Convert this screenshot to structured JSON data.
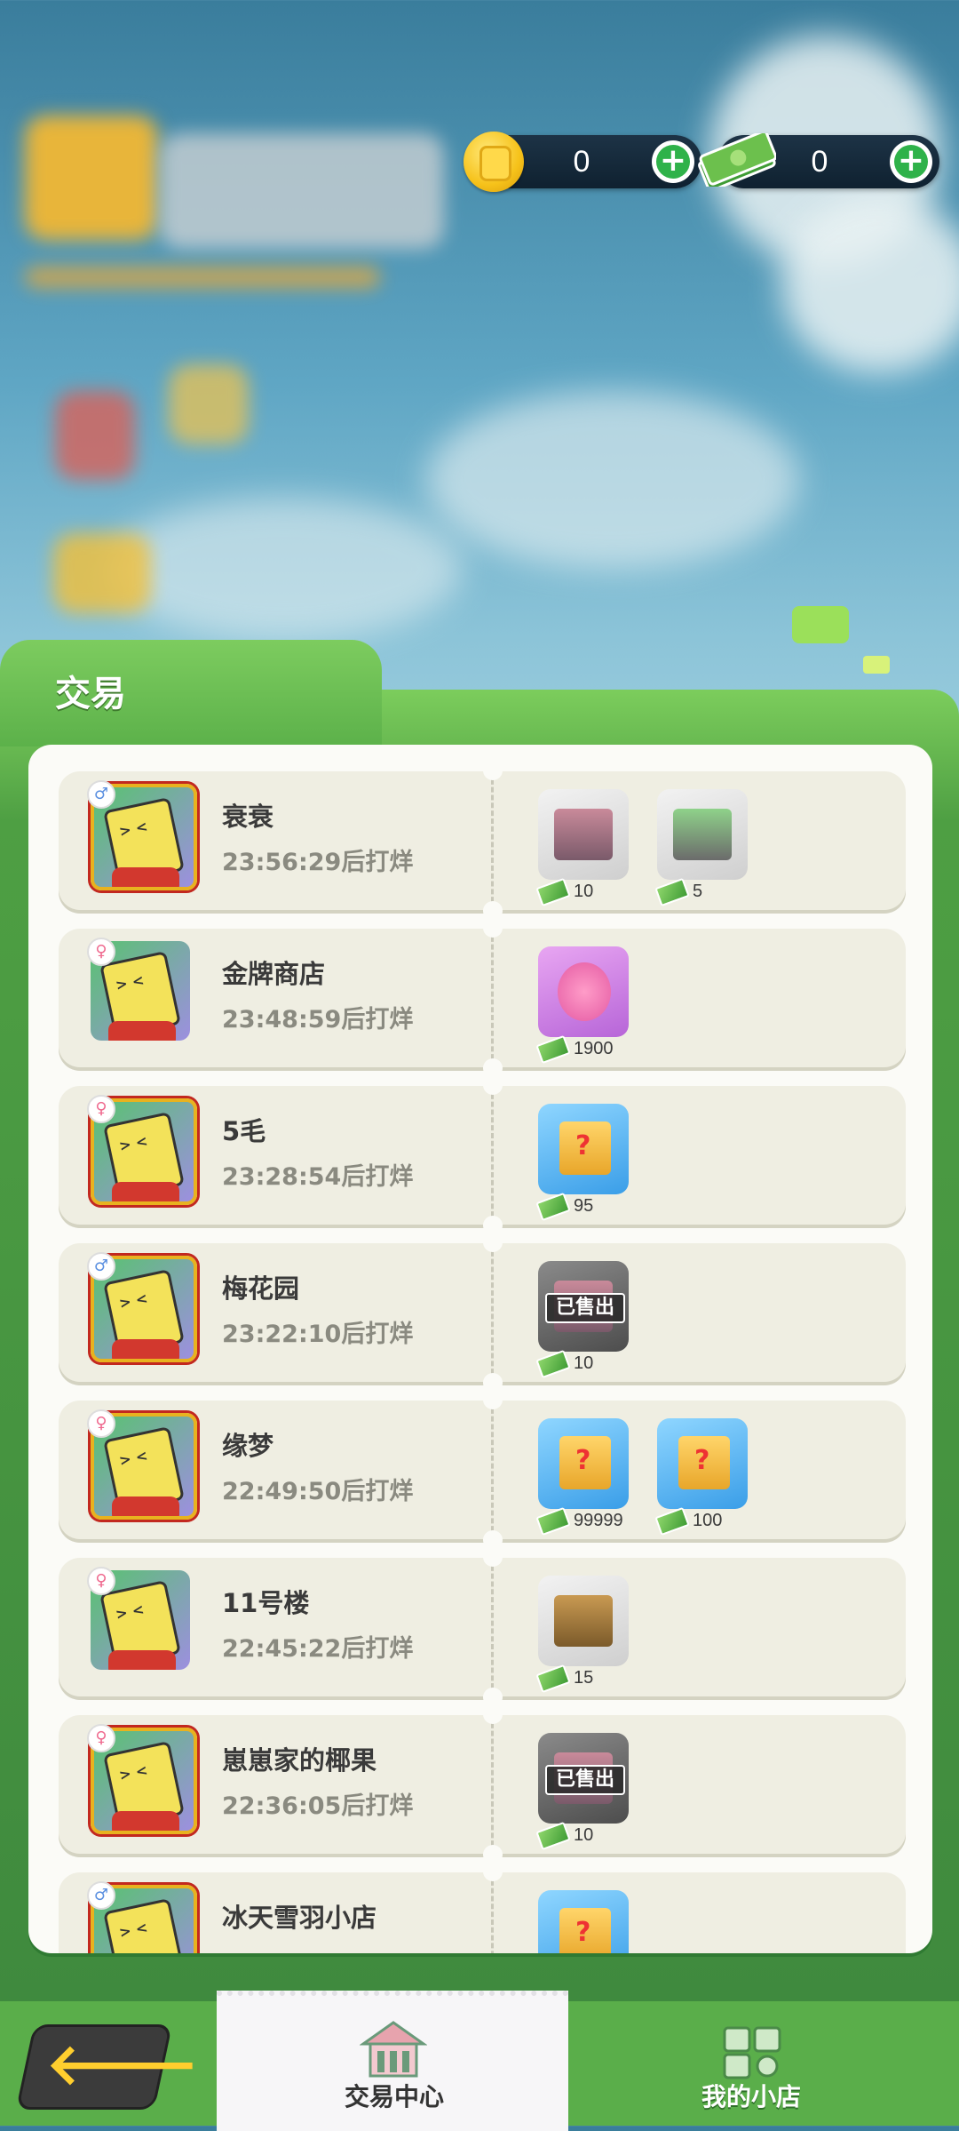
{
  "currency": {
    "coins": "0",
    "cash": "0",
    "coin_icon": "gold-coin-icon",
    "cash_icon": "cash-stack-icon",
    "add_icon": "plus-icon"
  },
  "panel": {
    "title": "交易"
  },
  "listings": [
    {
      "name": "衰衰",
      "timer": "23:56:29后打烊",
      "gender": "male",
      "framed": true,
      "items": [
        {
          "kind": "building",
          "price": "10",
          "sold": false
        },
        {
          "kind": "store",
          "price": "5",
          "sold": false
        }
      ]
    },
    {
      "name": "金牌商店",
      "timer": "23:48:59后打烊",
      "gender": "female",
      "framed": false,
      "items": [
        {
          "kind": "flower-gift",
          "price": "1900",
          "sold": false
        }
      ]
    },
    {
      "name": "5毛",
      "timer": "23:28:54后打烊",
      "gender": "female",
      "framed": true,
      "items": [
        {
          "kind": "mystery-box",
          "price": "95",
          "sold": false
        }
      ]
    },
    {
      "name": "梅花园",
      "timer": "23:22:10后打烊",
      "gender": "male",
      "framed": true,
      "items": [
        {
          "kind": "building",
          "price": "10",
          "sold": true
        }
      ]
    },
    {
      "name": "缘梦",
      "timer": "22:49:50后打烊",
      "gender": "female",
      "framed": true,
      "items": [
        {
          "kind": "mystery-box",
          "price": "99999",
          "sold": false
        },
        {
          "kind": "mystery-box",
          "price": "100",
          "sold": false
        }
      ]
    },
    {
      "name": "11号楼",
      "timer": "22:45:22后打烊",
      "gender": "female",
      "framed": false,
      "items": [
        {
          "kind": "farm",
          "price": "15",
          "sold": false
        }
      ]
    },
    {
      "name": "崽崽家的椰果",
      "timer": "22:36:05后打烊",
      "gender": "female",
      "framed": true,
      "items": [
        {
          "kind": "building",
          "price": "10",
          "sold": true
        }
      ]
    },
    {
      "name": "冰天雪羽小店",
      "timer": "",
      "gender": "male",
      "framed": true,
      "items": [
        {
          "kind": "mystery-box",
          "price": "",
          "sold": false
        }
      ]
    }
  ],
  "sold_label": "已售出",
  "nav": {
    "back_icon": "arrow-left-icon",
    "tabs": [
      {
        "label": "交易中心",
        "icon": "market-house-icon",
        "active": true
      },
      {
        "label": "我的小店",
        "icon": "shop-icon",
        "active": false
      }
    ]
  }
}
